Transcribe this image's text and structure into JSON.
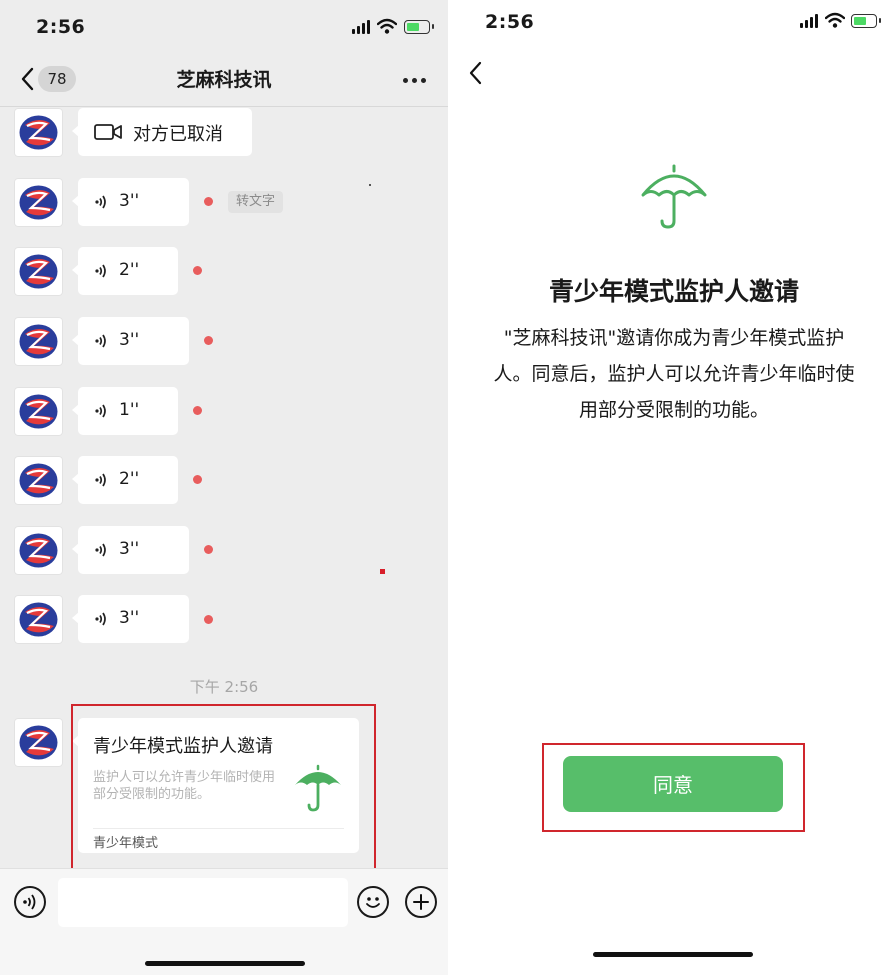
{
  "left": {
    "status": {
      "time": "2:56"
    },
    "nav": {
      "unread_count": "78",
      "title": "芝麻科技讯"
    },
    "messages": [
      {
        "type": "video-call",
        "text": "对方已取消"
      },
      {
        "type": "voice",
        "duration": "3''",
        "unread": true,
        "action": "转文字"
      },
      {
        "type": "voice",
        "duration": "2''",
        "unread": true
      },
      {
        "type": "voice",
        "duration": "3''",
        "unread": true
      },
      {
        "type": "voice",
        "duration": "1''",
        "unread": true
      },
      {
        "type": "voice",
        "duration": "2''",
        "unread": true
      },
      {
        "type": "voice",
        "duration": "3''",
        "unread": true
      },
      {
        "type": "voice",
        "duration": "3''",
        "unread": true
      }
    ],
    "time_label": "下午 2:56",
    "invite_card": {
      "title": "青少年模式监护人邀请",
      "description": "监护人可以允许青少年临时使用部分受限制的功能。",
      "footer": "青少年模式"
    }
  },
  "right": {
    "status": {
      "time": "2:56"
    },
    "title": "青少年模式监护人邀请",
    "description": "\"芝麻科技讯\"邀请你成为青少年模式监护人。同意后，监护人可以允许青少年临时使用部分受限制的功能。",
    "agree_button": "同意"
  },
  "colors": {
    "accent_green": "#57be6a",
    "unread_dot": "#e85d5d",
    "highlight_red": "#d0262d"
  }
}
